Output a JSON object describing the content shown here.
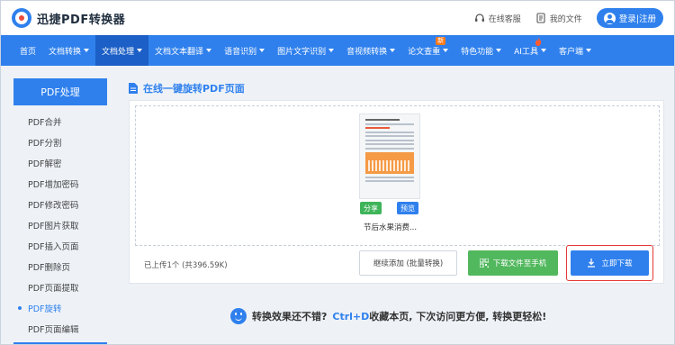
{
  "header": {
    "brand": "迅捷PDF转换器",
    "service_label": "在线客服",
    "files_label": "我的文件",
    "login_label": "登录|注册"
  },
  "nav": {
    "items": [
      {
        "label": "首页",
        "dropdown": false
      },
      {
        "label": "文档转换",
        "dropdown": true
      },
      {
        "label": "文档处理",
        "dropdown": true,
        "active": true
      },
      {
        "label": "文档文本翻译",
        "dropdown": true
      },
      {
        "label": "语音识别",
        "dropdown": true
      },
      {
        "label": "图片文字识别",
        "dropdown": true
      },
      {
        "label": "音视频转换",
        "dropdown": true
      },
      {
        "label": "论文查重",
        "dropdown": true,
        "badge": "新"
      },
      {
        "label": "特色功能",
        "dropdown": true
      },
      {
        "label": "AI工具",
        "dropdown": true,
        "flame": true
      },
      {
        "label": "客户端",
        "dropdown": true
      }
    ]
  },
  "sidebar": {
    "title": "PDF处理",
    "items": [
      {
        "label": "PDF合并"
      },
      {
        "label": "PDF分割"
      },
      {
        "label": "PDF解密"
      },
      {
        "label": "PDF增加密码"
      },
      {
        "label": "PDF修改密码"
      },
      {
        "label": "PDF图片获取"
      },
      {
        "label": "PDF插入页面"
      },
      {
        "label": "PDF删除页"
      },
      {
        "label": "PDF页面提取"
      },
      {
        "label": "PDF旋转",
        "active": true
      },
      {
        "label": "PDF页面编辑"
      }
    ]
  },
  "main": {
    "title": "在线一键旋转PDF页面",
    "file": {
      "name": "节后水果消费...",
      "share_label": "分享",
      "preview_label": "预览"
    },
    "upload_info": "已上传1个 (共396.59K)",
    "continue_label": "继续添加 (批量转换)",
    "phone_label": "下载文件至手机",
    "download_label": "立即下载"
  },
  "tip": {
    "before": "转换效果还不错?",
    "shortcut": "Ctrl+D",
    "after": "收藏本页, 下次访问更方便, 转换更轻松!"
  },
  "colors": {
    "primary": "#2f80ed",
    "green": "#52b85e",
    "highlight_outline": "#e53935"
  }
}
